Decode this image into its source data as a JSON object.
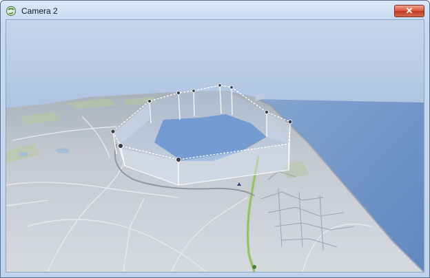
{
  "window": {
    "title": "Camera 2",
    "app_icon": "globe-camera-icon",
    "close_icon": "close-icon",
    "close_glyph": "✕"
  },
  "scene": {
    "sky_top": "#c4d3ea",
    "sky_bottom": "#7898c4",
    "sea": "#6f93c7",
    "terrain": "#c8ced6",
    "road": "#a7cc7c",
    "polygon_fill": "#a9c7ec"
  }
}
